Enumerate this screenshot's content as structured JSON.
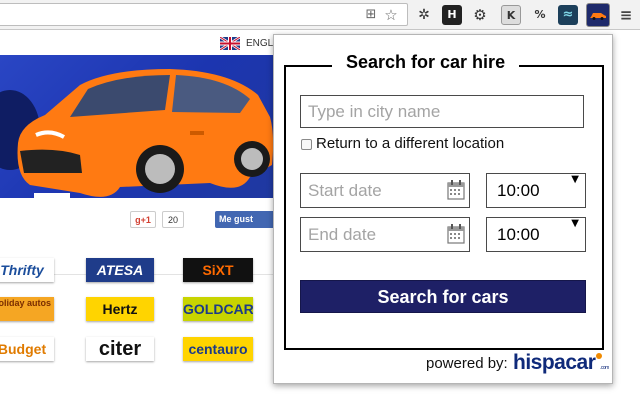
{
  "language": {
    "label": "ENGL"
  },
  "social": {
    "gplus_label": "g+1",
    "gplus_count": "20",
    "fb_label": "Me gust"
  },
  "brand_logos": [
    {
      "name": "thrifty",
      "text": "Thrifty",
      "bg": "#ffffff",
      "fg": "#1c4e9c"
    },
    {
      "name": "atesa",
      "text": "ATESA",
      "bg": "#1f3c8a",
      "fg": "#ffffff"
    },
    {
      "name": "sixt",
      "text": "SiXT",
      "bg": "#111111",
      "fg": "#ff6a00"
    },
    {
      "name": "holiday-autos",
      "text": "holiday autos",
      "bg": "#f5a623",
      "fg": "#7a2e00"
    },
    {
      "name": "hertz",
      "text": "Hertz",
      "bg": "#ffd400",
      "fg": "#111111"
    },
    {
      "name": "goldcar",
      "text": "GOLDCAR",
      "bg": "#c8d400",
      "fg": "#1b3a88"
    },
    {
      "name": "budget",
      "text": "Budget",
      "bg": "#ffffff",
      "fg": "#e07b00"
    },
    {
      "name": "citer",
      "text": "citer",
      "bg": "#ffffff",
      "fg": "#111111"
    },
    {
      "name": "centauro",
      "text": "centauro",
      "bg": "#ffd400",
      "fg": "#1b3a88"
    }
  ],
  "popup": {
    "title": "Search for car hire",
    "city_placeholder": "Type in city name",
    "return_label": "Return to a different location",
    "start_placeholder": "Start date",
    "end_placeholder": "End date",
    "start_time": "10:00",
    "end_time": "10:00",
    "search_button": "Search for cars",
    "powered_by": "powered by:",
    "brand_name": "hispacar",
    "brand_suffix": ".com"
  },
  "colors": {
    "accent": "#1e2066",
    "hero_bg": "#2a46c4",
    "car": "#ff7a12"
  },
  "toolbar_icons": [
    "translate-icon",
    "star-icon",
    "bug-icon",
    "h-extension-icon",
    "gear-icon",
    "k-extension-icon",
    "percent-icon",
    "wave-extension-icon",
    "car-extension-icon",
    "menu-icon"
  ]
}
